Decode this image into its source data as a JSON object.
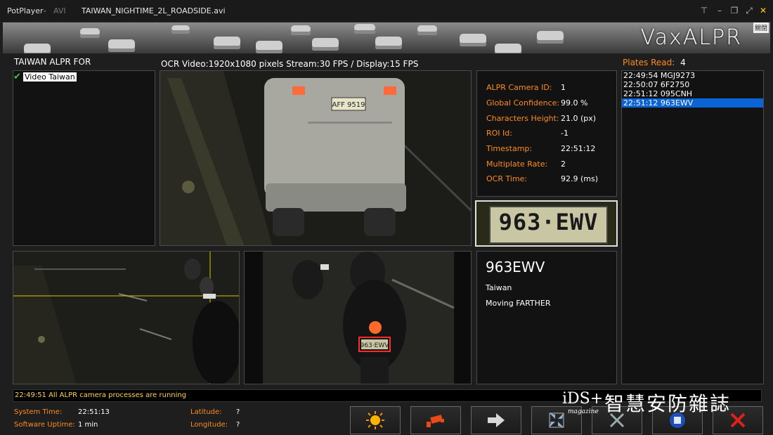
{
  "titlebar": {
    "app_name": "PotPlayer",
    "app_menu_icon": "chevron-down-icon",
    "format": "AVI",
    "file_name": "TAIWAN_NIGHTIME_2L_ROADSIDE.avi"
  },
  "banner": {
    "logo_text": "VaxALPR",
    "close_label": "關閉"
  },
  "left_panel": {
    "header": "TAIWAN ALPR FOR",
    "tree_item": "Video Taiwan"
  },
  "video": {
    "header": "OCR Video:1920x1080 pixels Stream:30 FPS / Display:15 FPS",
    "main_plate_text": "AFF 9519",
    "bottom_plate_text": "963·EWV"
  },
  "info": {
    "rows": [
      {
        "key": "ALPR Camera ID:",
        "value": "1"
      },
      {
        "key": "Global Confidence:",
        "value": "99.0 %"
      },
      {
        "key": "Characters Height:",
        "value": "21.0 (px)"
      },
      {
        "key": "ROI Id:",
        "value": "-1"
      },
      {
        "key": "Timestamp:",
        "value": "22:51:12"
      },
      {
        "key": "Multiplate Rate:",
        "value": "2"
      },
      {
        "key": "OCR Time:",
        "value": "92.9 (ms)"
      }
    ]
  },
  "plate_crop": {
    "text": "963·EWV"
  },
  "result": {
    "plate": "963EWV",
    "country": "Taiwan",
    "direction": "Moving FARTHER"
  },
  "plates_read": {
    "label": "Plates Read:",
    "count": "4",
    "items": [
      "22:49:54 MGJ9273",
      "22:50:07 6F2750",
      "22:51:12 095CNH",
      "22:51:12 963EWV"
    ],
    "selected_index": 3
  },
  "status_bar": {
    "message": "22:49:51 All ALPR camera processes are running"
  },
  "system": {
    "system_time_label": "System Time:",
    "system_time": "22:51:13",
    "uptime_label": "Software Uptime:",
    "uptime": "1 min",
    "latitude_label": "Latitude:",
    "latitude": "?",
    "longitude_label": "Longitude:",
    "longitude": "?"
  },
  "watermark": {
    "brand": "iDS+",
    "sub": "magazine",
    "chinese": "智慧安防雜誌"
  },
  "toolbar": {
    "buttons": [
      "sun-icon",
      "camera-icon",
      "arrow-right-icon",
      "shrink-icon",
      "x-icon",
      "stop-icon",
      "close-red-icon"
    ]
  },
  "colors": {
    "accent_orange": "#ff8c1a",
    "selection_blue": "#0a64d6",
    "status_yellow": "#ffd24d"
  }
}
